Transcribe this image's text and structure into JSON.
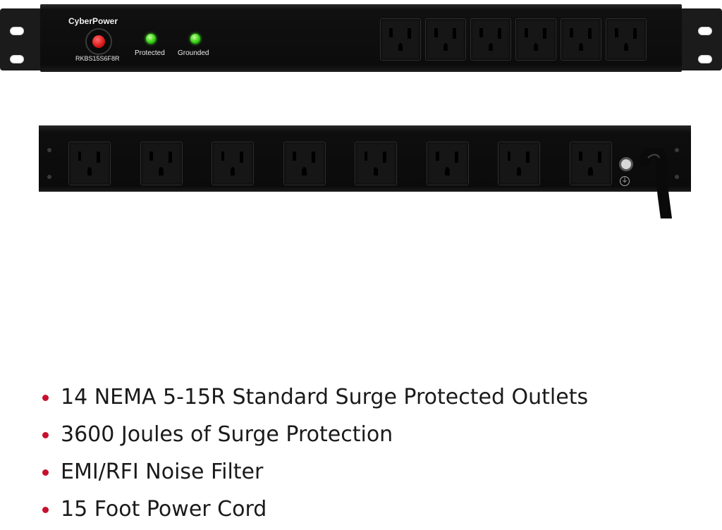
{
  "front_panel": {
    "brand": "CyberPower",
    "model": "RKBS15S6F8R",
    "indicators": [
      {
        "label": "Protected",
        "state": "on",
        "color": "#35d414"
      },
      {
        "label": "Grounded",
        "state": "on",
        "color": "#35d414"
      }
    ],
    "power_button_color": "#d81818",
    "outlet_count": 6
  },
  "rear_panel": {
    "outlet_count": 8,
    "has_ground_post": true,
    "has_power_cord": true
  },
  "features": {
    "bullet_color": "#c8102e",
    "items": [
      {
        "text": "14 NEMA 5-15R Standard Surge Protected Outlets"
      },
      {
        "text": "3600 Joules of Surge Protection"
      },
      {
        "text": "EMI/RFI Noise Filter"
      },
      {
        "text": "15 Foot Power Cord"
      }
    ]
  }
}
